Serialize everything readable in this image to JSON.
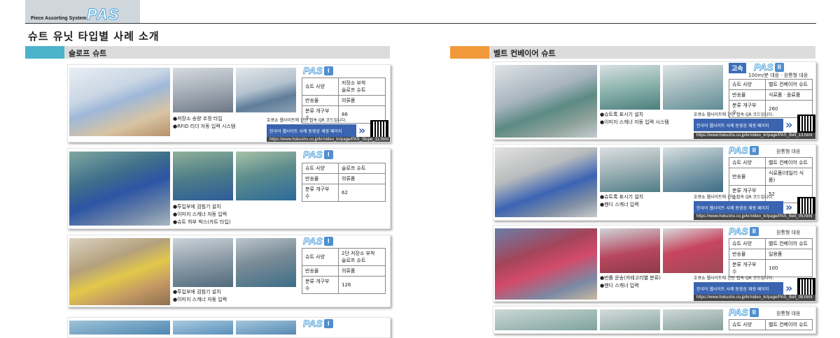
{
  "header": {
    "system_label": "Piece Assorting System",
    "logo_text": "PAS",
    "page_title": "슈트 유닛 타입별 사례 소개"
  },
  "left_section": {
    "title": "슬로프 슈트",
    "accent_color": "#4db2cc",
    "cards": [
      {
        "badge": "PAS",
        "badge_roman": "I",
        "spec": [
          [
            "슈트 사양",
            "저장소 부착\n슬로프 슈트"
          ],
          [
            "반송물",
            "의류품"
          ],
          [
            "분류 개구부 수",
            "86"
          ]
        ],
        "bullets": [
          "●저장소 송량 조정 타입",
          "●RFID 리더 자동 입력 시스템"
        ],
        "qr_text": "호큐쇼 웹사이트에 간단 접속 QR 코드입니다.",
        "qr_button": "한국어 웹사이트 사례 동영상 재생 페이지",
        "url": "https://www.hokusho.co.jp/kr/video_kr/page/PAS_Slope_11.html"
      },
      {
        "badge": "PAS",
        "badge_roman": "I",
        "spec": [
          [
            "슈트 사양",
            "슬로프 슈트"
          ],
          [
            "반송물",
            "의류품"
          ],
          [
            "분류 개구부 수",
            "62"
          ]
        ],
        "bullets": [
          "●투입부에 검침기 설치",
          "●이미지 스캐너 자동 입력",
          "●슈트 하부 박스(카트 타입)"
        ]
      },
      {
        "badge": "PAS",
        "badge_roman": "I",
        "spec": [
          [
            "슈트 사양",
            "2단 저장소 부착\n슬로프 슈트"
          ],
          [
            "반송물",
            "의류품"
          ],
          [
            "분류 개구부 수",
            "126"
          ]
        ],
        "bullets": [
          "●투입부에 검침기 설치",
          "●이미지 스캐너 자동 입력"
        ]
      },
      {
        "badge": "PAS",
        "badge_roman": "I"
      }
    ]
  },
  "right_section": {
    "title": "벨트 컨베이어 슈트",
    "accent_color": "#f29a3a",
    "cards": [
      {
        "kind": "고속",
        "badge": "PAS",
        "badge_roman": "II",
        "note": "100m/분 대응 · 원통형 대응",
        "spec": [
          [
            "슈트 사양",
            "벨트 컨베이어 슈트"
          ],
          [
            "반송물",
            "식료품 · 음료품"
          ],
          [
            "분류 개구부 수",
            "260"
          ]
        ],
        "bullets": [
          "●슈트록 표시기 설치",
          "●이미지 스캐너 자동 입력 시스템"
        ],
        "qr_text": "호큐쇼 웹사이트에 간단 접속 QR 코드입니다.",
        "qr_button": "한국어 웹사이트 사례 동영상 재생 페이지",
        "url": "https://www.hokusho.co.jp/kr/video_kr/page/PAS_Belt_13.html"
      },
      {
        "badge": "PAS",
        "badge_roman": "II",
        "note": "원통형 대응",
        "spec": [
          [
            "슈트 사양",
            "벨트 컨베이어 슈트"
          ],
          [
            "반송물",
            "식료품(데일리 식품)"
          ],
          [
            "분류 개구부 수",
            "52"
          ]
        ],
        "bullets": [
          "●슈트록 표시기 설치",
          "●핸디 스캐너 입력"
        ],
        "qr_text": "호큐쇼 웹사이트에 간단 접속 QR 코드입니다.",
        "qr_button": "한국어 웹사이트 사례 동영상 재생 페이지",
        "url": "https://www.hokusho.co.jp/kr/video_kr/page/PAS_Belt_05.html"
      },
      {
        "badge": "PAS",
        "badge_roman": "II",
        "note": "원통형 대응",
        "spec": [
          [
            "슈트 사양",
            "벨트 컨베이어 슈트"
          ],
          [
            "반송물",
            "일용품"
          ],
          [
            "분류 개구부 수",
            "100"
          ]
        ],
        "bullets": [
          "●반품 운송(카테고리별 분류)",
          "●핸디 스캐너 입력"
        ],
        "qr_text": "호큐쇼 웹사이트에 간단 접속 QR 코드입니다.",
        "qr_button": "한국어 웹사이트 사례 동영상 재생 페이지",
        "url": "https://www.hokusho.co.jp/kr/video_kr/page/PAS_Belt_08.html"
      },
      {
        "badge": "PAS",
        "badge_roman": "II",
        "note": "원통형 대응",
        "spec": [
          [
            "슈트 사양",
            "벨트 컨베이어 슈트"
          ]
        ]
      }
    ]
  }
}
